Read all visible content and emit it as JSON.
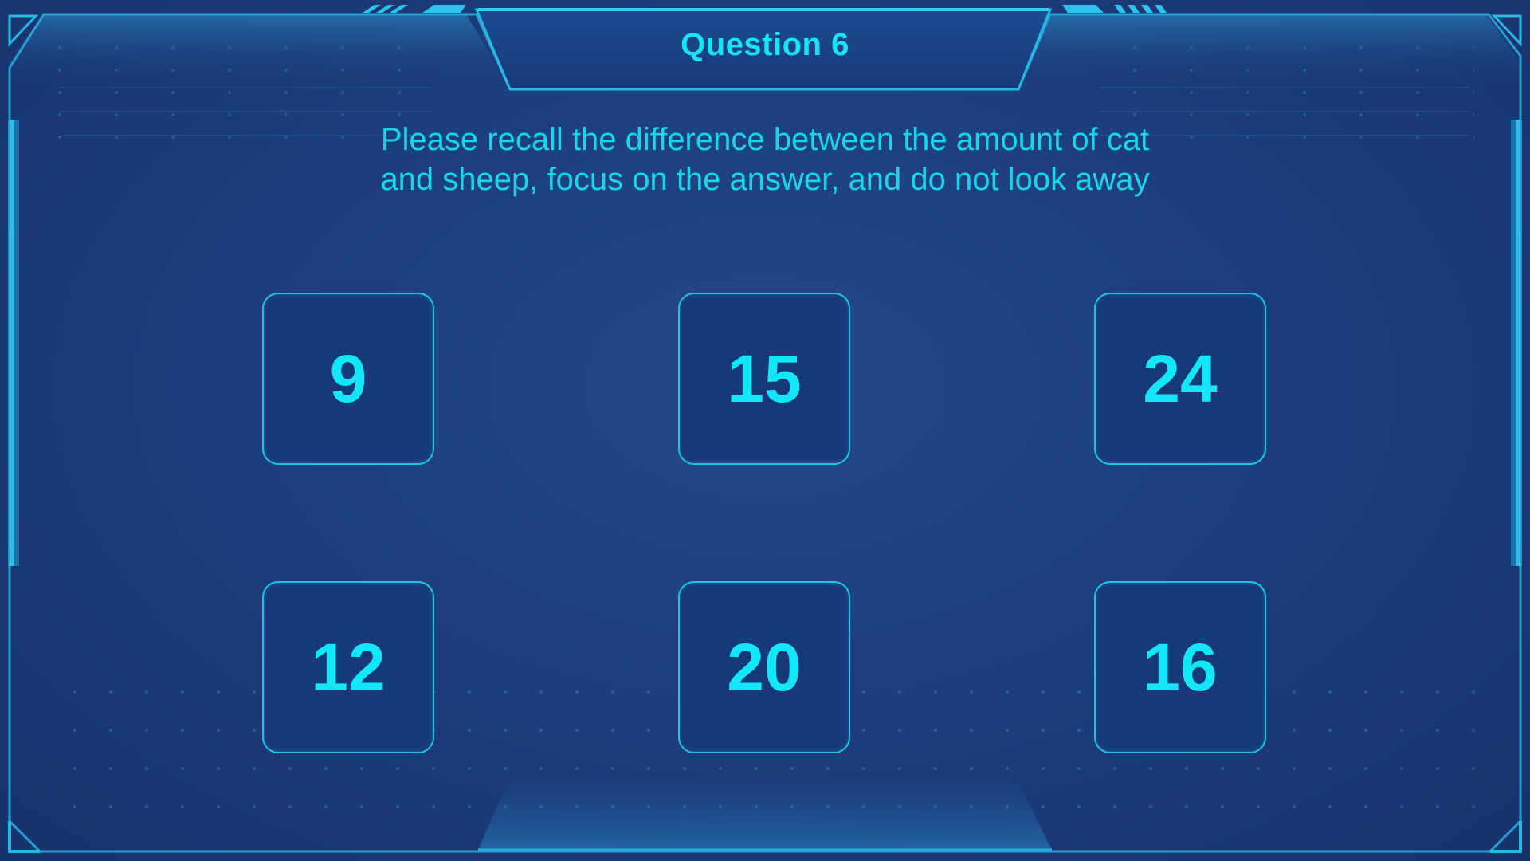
{
  "quiz": {
    "title": "Question 6",
    "prompt": "Please recall the difference between the amount of cat and sheep, focus on the answer, and do not look away",
    "options": [
      "9",
      "15",
      "24",
      "12",
      "20",
      "16"
    ]
  },
  "theme": {
    "accent": "#12e6f8",
    "background": "#1d3f7e",
    "frame": "#27b9e6"
  }
}
